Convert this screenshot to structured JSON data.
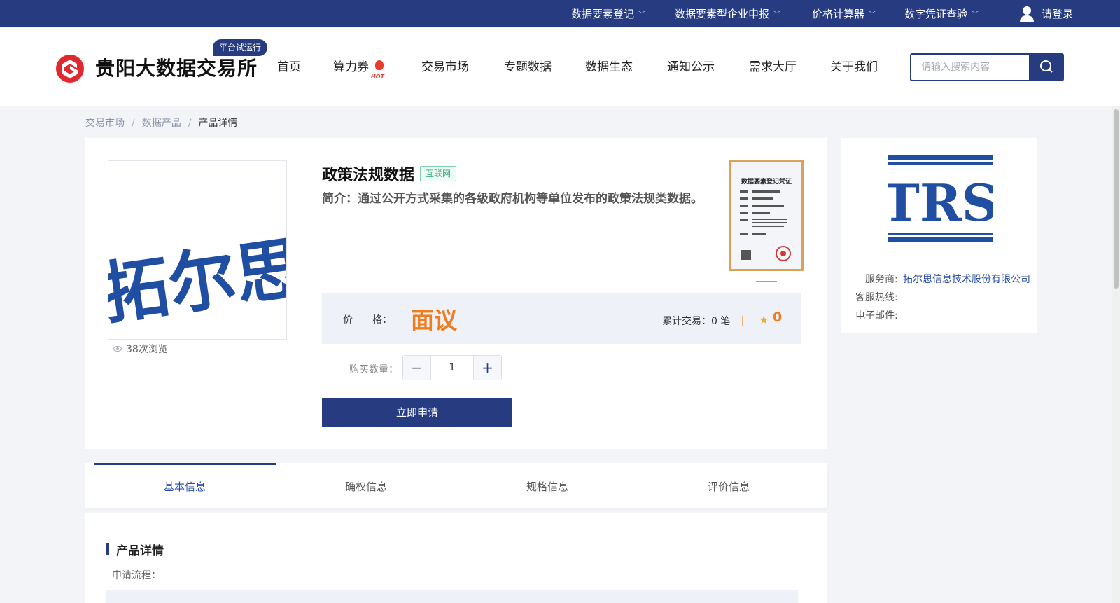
{
  "topbar": {
    "links": [
      {
        "label": "数据要素登记"
      },
      {
        "label": "数据要素型企业申报"
      },
      {
        "label": "价格计算器"
      },
      {
        "label": "数字凭证查验"
      }
    ],
    "login": "请登录"
  },
  "header": {
    "logo_text": "贵阳大数据交易所",
    "badge": "平台试运行",
    "nav": [
      "首页",
      "算力券",
      "交易市场",
      "专题数据",
      "数据生态",
      "通知公示",
      "需求大厅",
      "关于我们"
    ],
    "hot_label": "HOT",
    "search_placeholder": "请输入搜索内容"
  },
  "breadcrumb": [
    "交易市场",
    "数据产品",
    "产品详情"
  ],
  "product": {
    "title": "政策法规数据",
    "tag": "互联网",
    "desc": "简介：通过公开方式采集的各级政府机构等单位发布的政策法规类数据。",
    "image_text": "拓尔思",
    "views": "38次浏览",
    "certificate_title": "数据要素登记凭证",
    "price_label": "价　　格：",
    "price": "面议",
    "trade_count": "累计交易：0 笔",
    "rating": "0",
    "qty_label": "购买数量：",
    "qty": "1",
    "apply": "立即申请"
  },
  "vendor": {
    "logo_text": "TRS",
    "provider_label": "服务商:",
    "provider": "拓尔思信息技术股份有限公司",
    "hotline_label": "客服热线:",
    "email_label": "电子邮件:"
  },
  "tabs": [
    "基本信息",
    "确权信息",
    "规格信息",
    "评价信息"
  ],
  "detail": {
    "title": "产品详情",
    "flow_label": "申请流程："
  },
  "colors": {
    "primary": "#263b80",
    "accent": "#f07c1e",
    "link": "#2a4fa8"
  }
}
